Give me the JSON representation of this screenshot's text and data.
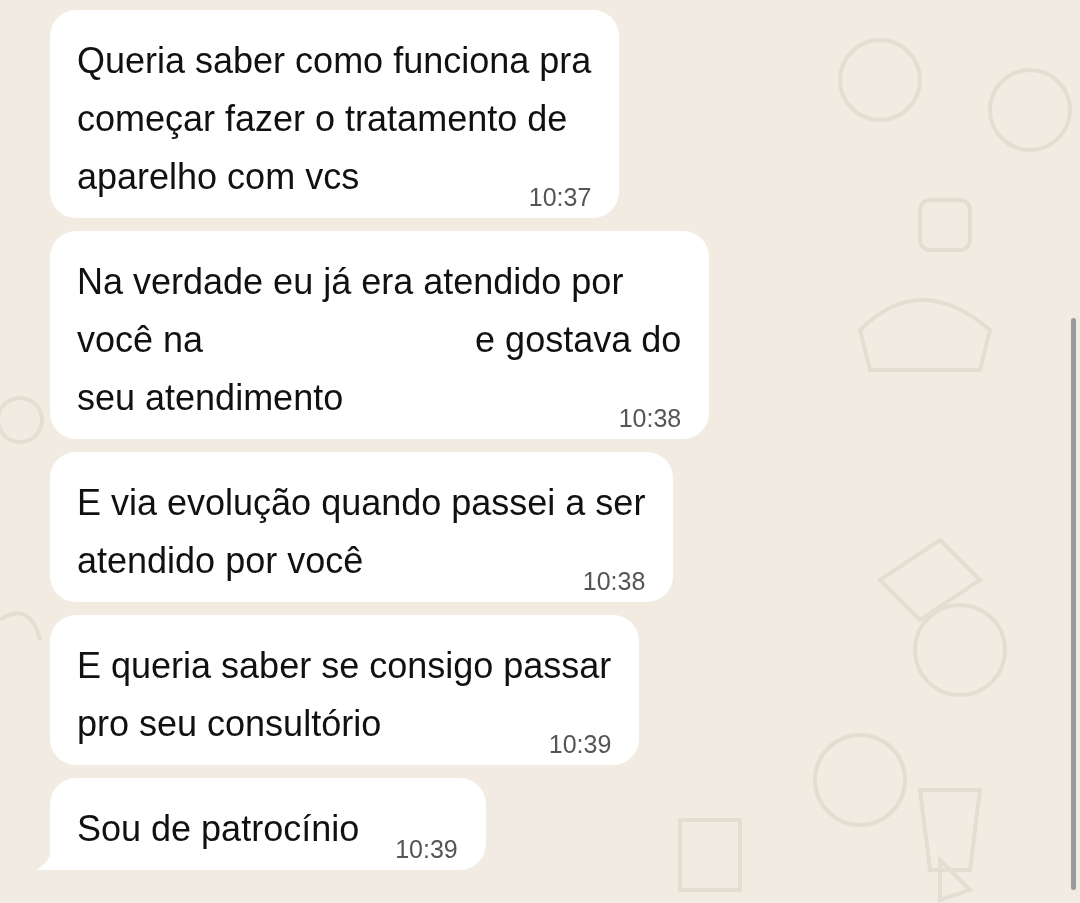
{
  "messages": [
    {
      "lines": [
        [
          "Queria saber como funciona pra"
        ],
        [
          "começar fazer o tratamento de"
        ],
        [
          "aparelho com vcs"
        ]
      ],
      "time": "10:37",
      "tail": false
    },
    {
      "lines": [
        [
          "Na verdade eu já era  atendido por"
        ],
        [
          "você na",
          "e gostava do"
        ],
        [
          "seu atendimento"
        ]
      ],
      "time": "10:38",
      "tail": false
    },
    {
      "lines": [
        [
          "E via evolução quando passei a ser"
        ],
        [
          "atendido por você"
        ]
      ],
      "time": "10:38",
      "tail": false
    },
    {
      "lines": [
        [
          "E queria saber se consigo passar"
        ],
        [
          "pro seu consultório"
        ]
      ],
      "time": "10:39",
      "tail": false
    },
    {
      "lines": [
        [
          "Sou de patrocínio"
        ]
      ],
      "time": "10:39",
      "tail": true
    }
  ]
}
